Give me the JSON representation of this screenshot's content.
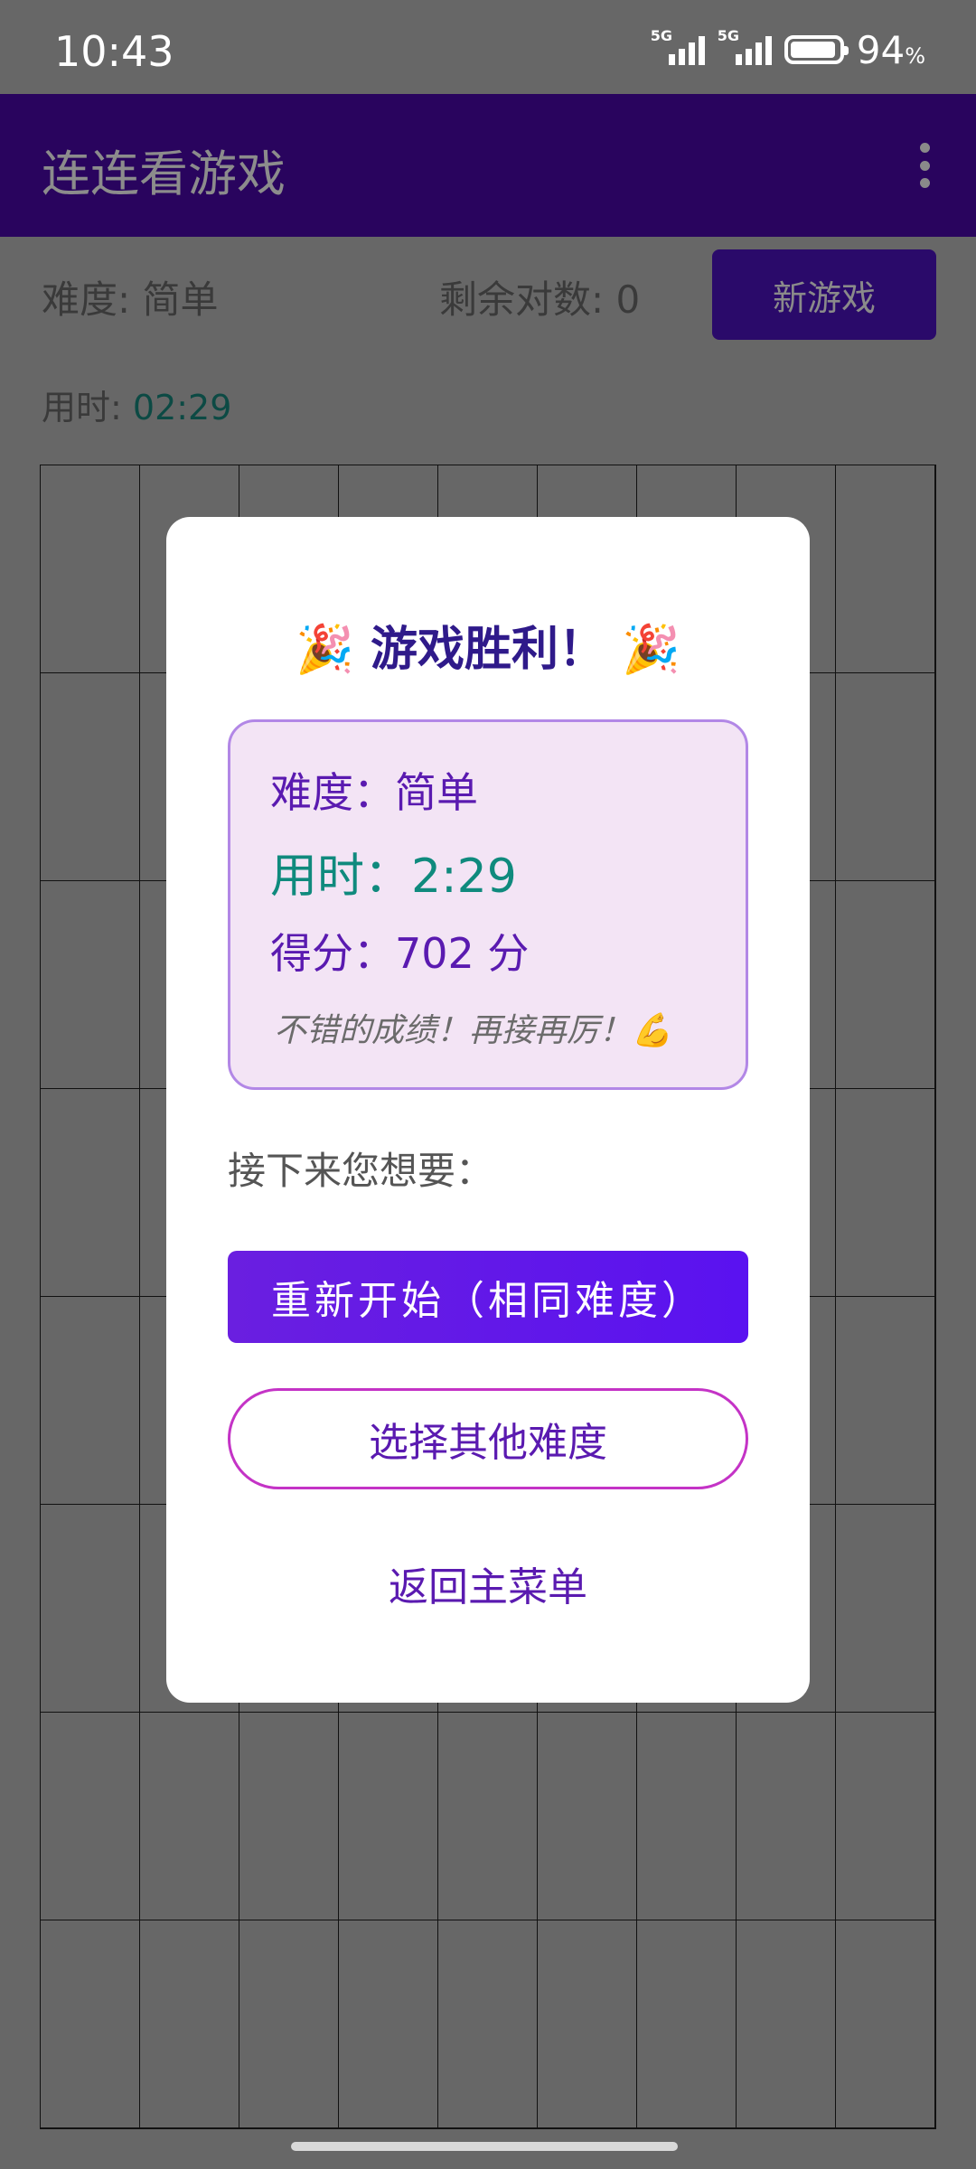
{
  "status_bar": {
    "time": "10:43",
    "network_1": "5G",
    "network_2": "5G",
    "battery_percent": "94",
    "battery_unit": "%"
  },
  "app_bar": {
    "title": "连连看游戏",
    "more_icon": "more-vert-icon"
  },
  "game_info": {
    "difficulty": "难度: 简单",
    "pairs_remaining": "剩余对数: 0",
    "new_game_label": "新游戏",
    "time_label": "用时: ",
    "time_value": "02:29"
  },
  "victory_dialog": {
    "title": "🎉 游戏胜利！ 🎉",
    "difficulty": "难度：简单",
    "time": "用时：2:29",
    "score": "得分：702 分",
    "praise": "不错的成绩！再接再厉！💪",
    "next_prompt": "接下来您想要：",
    "restart_label": "重新开始（相同难度）",
    "other_difficulty_label": "选择其他难度",
    "main_menu_label": "返回主菜单"
  },
  "colors": {
    "app_bar": "#29045e",
    "accent": "#6a1fe0",
    "teal": "#0f8a7d",
    "overlay": "#676767"
  }
}
